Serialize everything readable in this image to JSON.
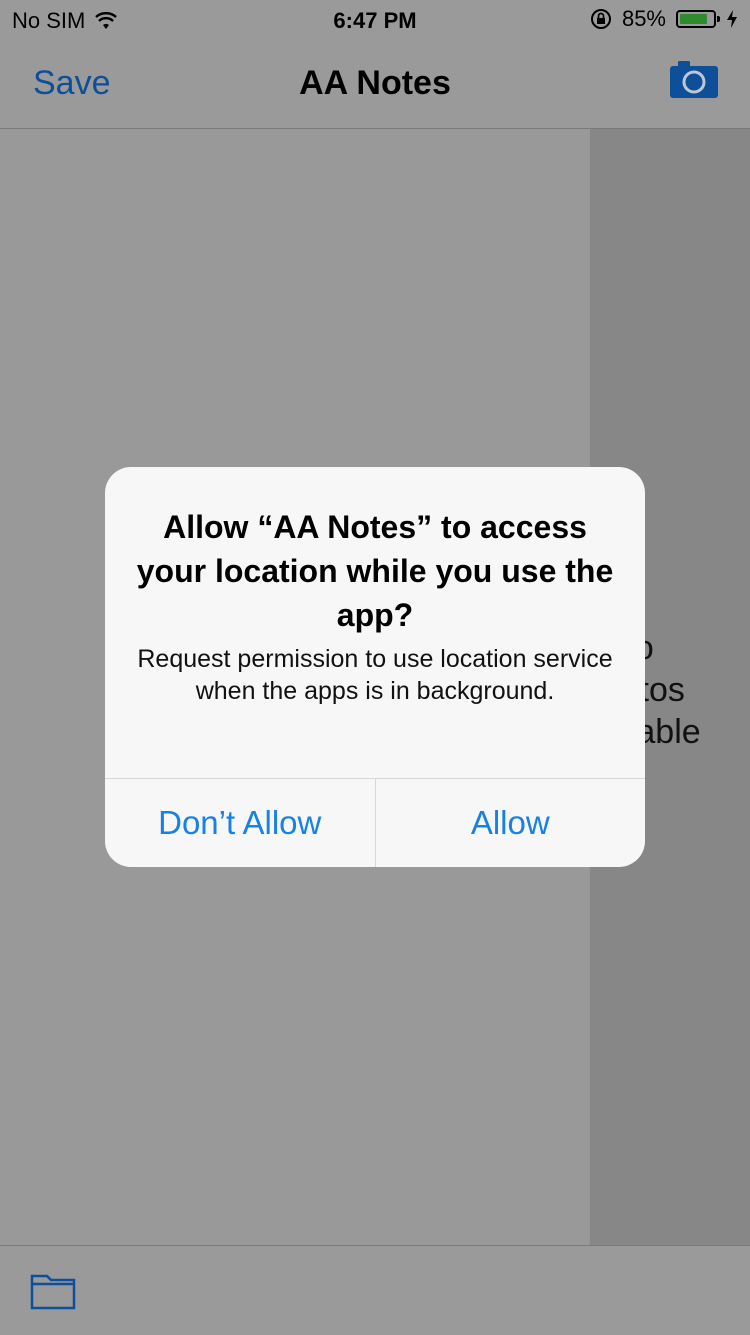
{
  "status_bar": {
    "carrier": "No SIM",
    "time": "6:47 PM",
    "battery_percent": "85%",
    "battery_level": 0.85,
    "icons": [
      "wifi-icon",
      "orientation-lock-icon",
      "battery-icon",
      "charging-icon"
    ]
  },
  "navbar": {
    "save_label": "Save",
    "title": "AA Notes",
    "camera_icon": "camera-icon"
  },
  "side_panel": {
    "empty_text_line1": "No",
    "empty_text_line2": "Photos",
    "empty_text_line3": "Available"
  },
  "toolbar": {
    "folder_icon": "folder-icon"
  },
  "alert": {
    "title": "Allow “AA Notes” to access your location while you use the app?",
    "message": "Request permission to use location service when the apps is in background.",
    "deny_label": "Don’t Allow",
    "allow_label": "Allow"
  },
  "colors": {
    "accent": "#1781e6",
    "dim_accent": "#0d4f98",
    "overlay_bg": "#999999",
    "alert_bg": "#f7f7f7"
  }
}
